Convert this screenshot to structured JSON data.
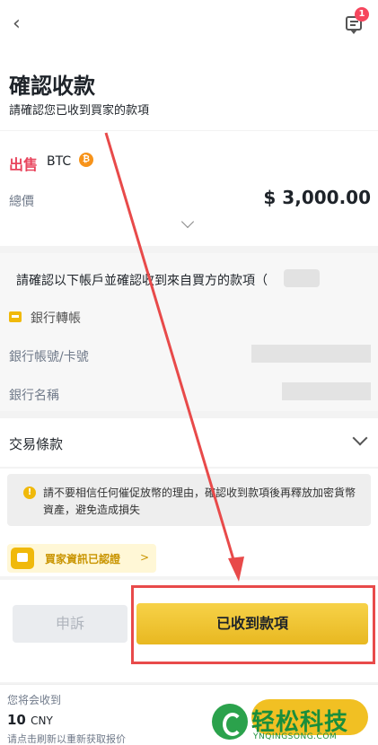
{
  "header": {
    "badge_count": "1",
    "title": "確認收款",
    "subtitle": "請確認您已收到買家的款項"
  },
  "order": {
    "side": "出售",
    "asset": "BTC",
    "asset_icon": "₿",
    "total_label": "總價",
    "total_value": "$  3,000.00"
  },
  "payment": {
    "confirm_prefix": "請確認以下帳戶並確認收到來自買方的款項（",
    "confirm_suffix": "）",
    "method": "銀行轉帳",
    "account_label": "銀行帳號/卡號",
    "bank_name_label": "銀行名稱"
  },
  "terms": {
    "label": "交易條款"
  },
  "notice": {
    "icon_glyph": "!",
    "text": "請不要相信任何催促放幣的理由，確認收到款項後再釋放加密貨幣資產，避免造成損失"
  },
  "verified": {
    "label": "買家資訊已認證",
    "chevron": ">"
  },
  "actions": {
    "appeal_label": "申訴",
    "received_label": "已收到款項"
  },
  "footer": {
    "receive_label": "您将会收到",
    "amount": "10",
    "unit": "CNY",
    "refresh_note": "请点击刷新以重新获取报价"
  },
  "watermark": {
    "title": "轻松科技",
    "subtitle": "YNQINGSONG.COM"
  },
  "colors": {
    "sell_red": "#e8455d",
    "brand_yellow": "#f0b90b",
    "annotation_red": "#e84a4a"
  }
}
